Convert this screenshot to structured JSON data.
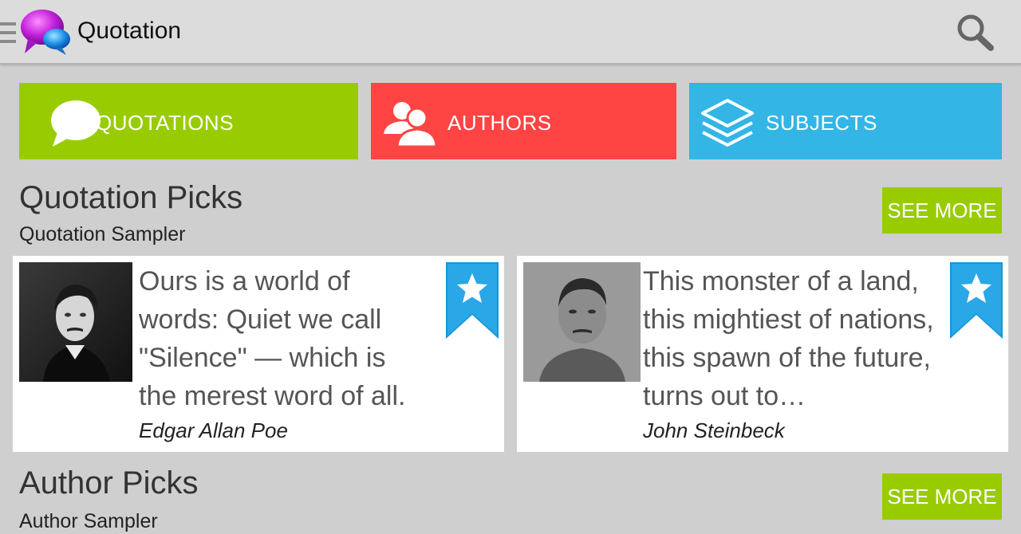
{
  "app": {
    "title": "Quotation"
  },
  "colors": {
    "quotations": "#99cc00",
    "authors": "#ff4444",
    "subjects": "#33b5e5",
    "see_more": "#99cc00"
  },
  "icons": {
    "drawer": "drawer-menu-icon",
    "logo": "speech-bubbles-logo",
    "search": "search-icon",
    "quotations": "speech-bubble-icon",
    "authors": "people-icon",
    "subjects": "layers-icon",
    "bookmark": "star-bookmark-icon"
  },
  "tiles": [
    {
      "label": "QUOTATIONS"
    },
    {
      "label": "AUTHORS"
    },
    {
      "label": "SUBJECTS"
    }
  ],
  "quotation_picks": {
    "title": "Quotation Picks",
    "subtitle": "Quotation Sampler",
    "see_more": "SEE MORE",
    "cards": [
      {
        "quote": "Ours is a world of words: Quiet we call \"Silence\" — which is the merest word of all.",
        "author": "Edgar Allan Poe"
      },
      {
        "quote": "This monster of a land, this mightiest of nations, this spawn of the future, turns out to…",
        "author": "John Steinbeck"
      }
    ]
  },
  "author_picks": {
    "title": "Author Picks",
    "subtitle": "Author Sampler",
    "see_more": "SEE MORE"
  }
}
